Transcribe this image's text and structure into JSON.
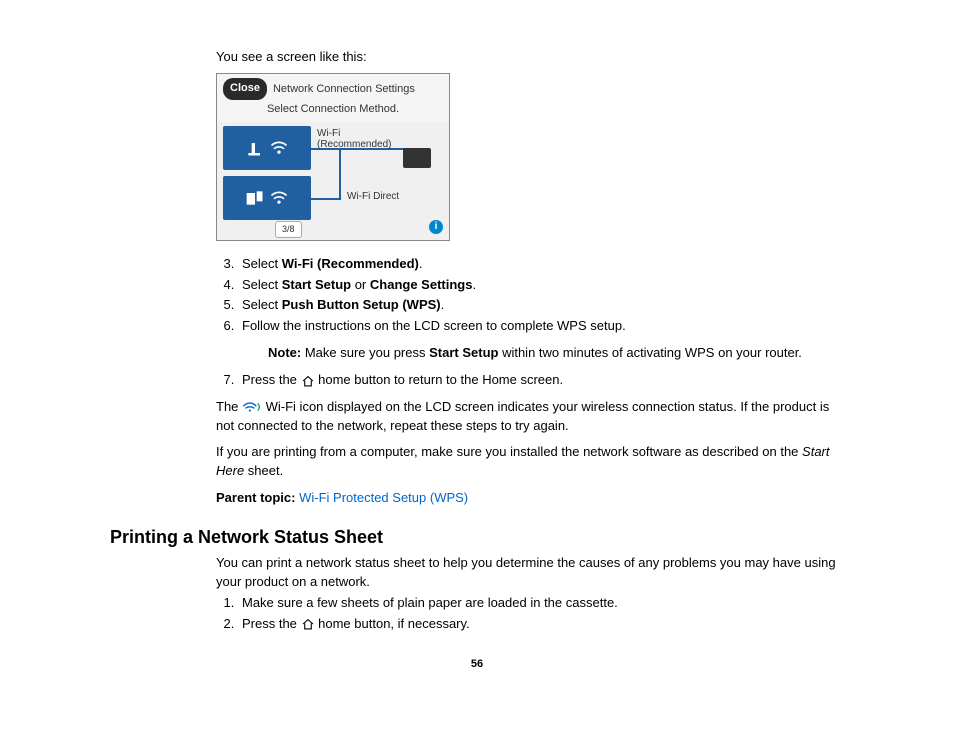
{
  "intro": "You see a screen like this:",
  "figure": {
    "close": "Close",
    "title": "Network Connection Settings",
    "subtitle": "Select Connection Method.",
    "opt1": "Wi-Fi\n(Recommended)",
    "opt2": "Wi-Fi Direct",
    "pager": "3/8"
  },
  "steps": {
    "s3a": "Select ",
    "s3b": "Wi-Fi (Recommended)",
    "s3c": ".",
    "s4a": "Select ",
    "s4b": "Start Setup",
    "s4c": " or ",
    "s4d": "Change Settings",
    "s4e": ".",
    "s5a": "Select ",
    "s5b": "Push Button Setup (WPS)",
    "s5c": ".",
    "s6": "Follow the instructions on the LCD screen to complete WPS setup.",
    "note_a": "Note:",
    "note_b": " Make sure you press ",
    "note_c": "Start Setup",
    "note_d": " within two minutes of activating WPS on your router.",
    "s7a": "Press the ",
    "s7b": " home button to return to the Home screen."
  },
  "after": {
    "p1a": "The ",
    "p1b": " Wi-Fi icon displayed on the LCD screen indicates your wireless connection status. If the product is not connected to the network, repeat these steps to try again.",
    "p2a": "If you are printing from a computer, make sure you installed the network software as described on the ",
    "p2b": "Start Here",
    "p2c": " sheet.",
    "parent_label": "Parent topic:",
    "parent_link": "Wi-Fi Protected Setup (WPS)"
  },
  "section2": {
    "heading": "Printing a Network Status Sheet",
    "intro": "You can print a network status sheet to help you determine the causes of any problems you may have using your product on a network.",
    "s1": "Make sure a few sheets of plain paper are loaded in the cassette.",
    "s2a": "Press the ",
    "s2b": " home button, if necessary."
  },
  "pagenum": "56"
}
